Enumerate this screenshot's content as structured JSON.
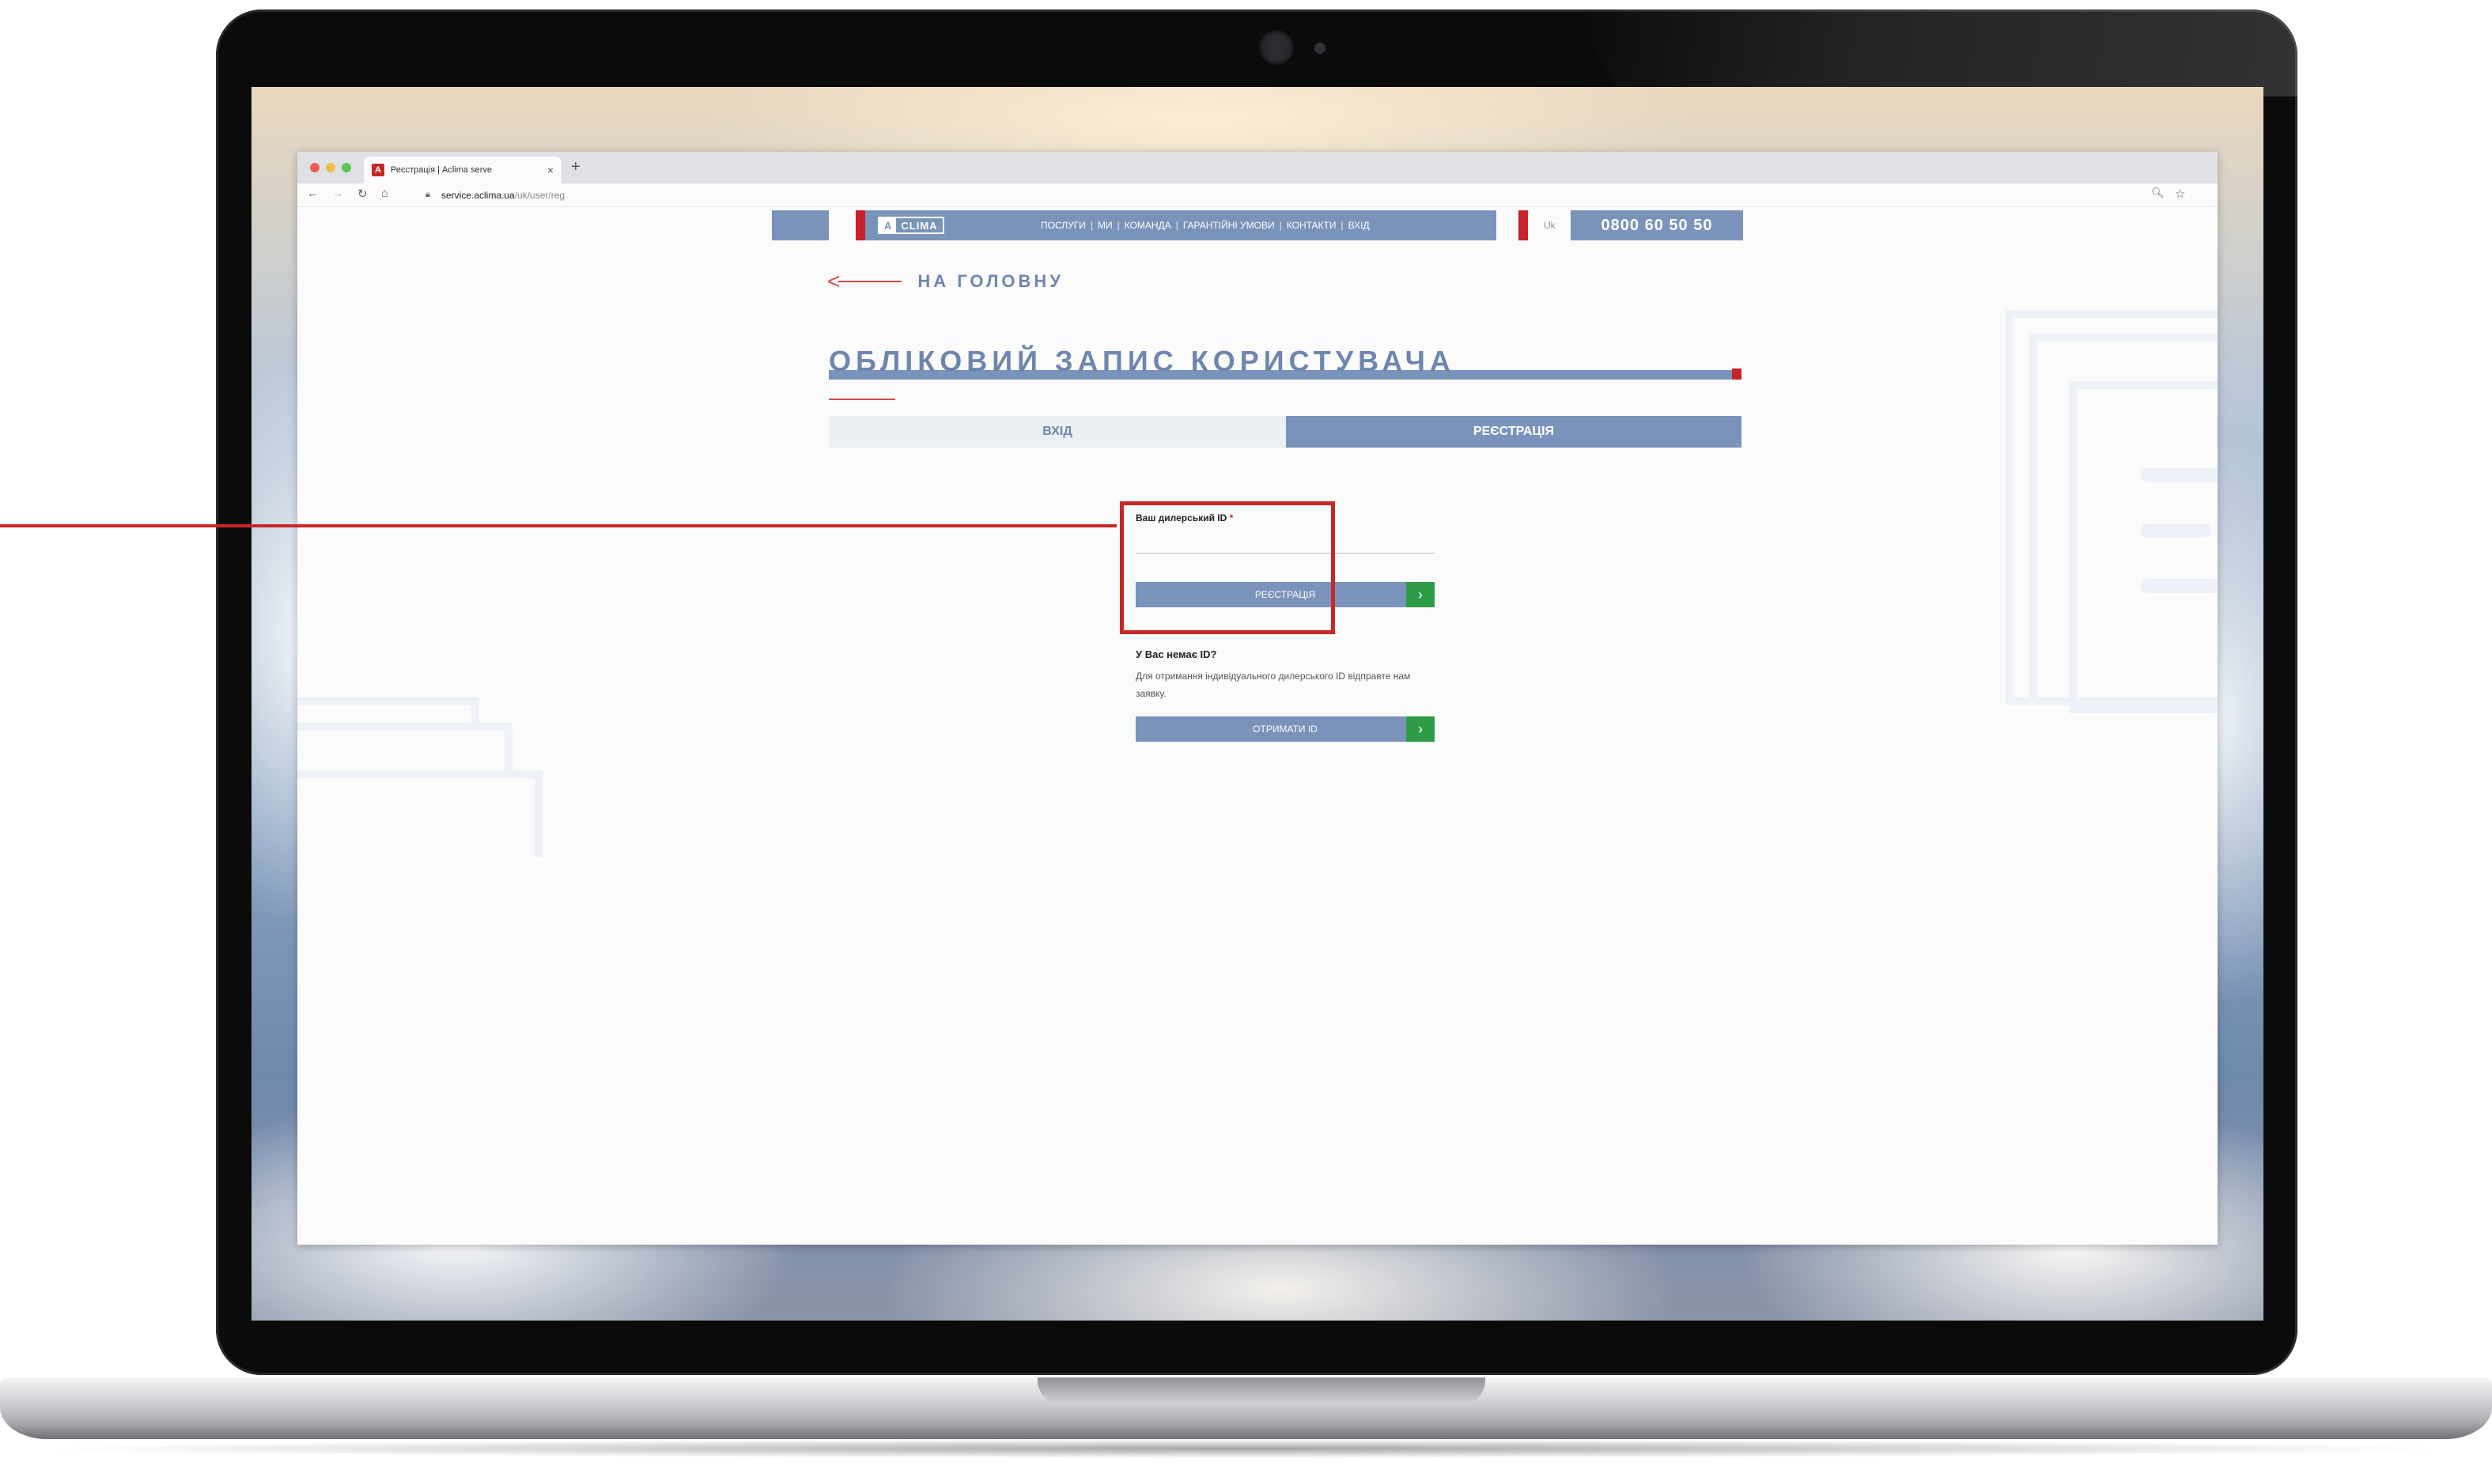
{
  "browser": {
    "tab_title": "Реєстрація | Aclima serve",
    "tab_close": "×",
    "new_tab": "+",
    "url_host": "service.aclima.ua",
    "url_path": "/uk/user/reg",
    "favicon_letter": "A"
  },
  "header": {
    "logo_a": "A",
    "logo_text": "CLIMA",
    "nav": [
      "ПОСЛУГИ",
      "МИ",
      "КОМАНДА",
      "ГАРАНТІЙНІ УМОВИ",
      "КОНТАКТИ",
      "ВХІД"
    ],
    "nav_separator": "|",
    "lang": "Uk",
    "phone": "0800 60 50 50"
  },
  "back": {
    "arrow": "<",
    "label": "НА ГОЛОВНУ"
  },
  "page_title": "ОБЛІКОВИЙ ЗАПИС КОРИСТУВАЧА",
  "tabs": {
    "login": "ВХІД",
    "register": "РЕЄСТРАЦІЯ"
  },
  "form": {
    "label": "Ваш дилерський ID",
    "required_mark": "*",
    "input_value": "",
    "submit": "РЕЄСТРАЦІЯ",
    "go_glyph": "›"
  },
  "no_id": {
    "title": "У Вас немає ID?",
    "text": "Для отримання індивідуального дилерського ID відправте нам заявку.",
    "button": "ОТРИМАТИ ID"
  },
  "colors": {
    "brand_blue": "#7a93bb",
    "accent_red": "#c8222a",
    "go_green": "#2e9b47",
    "highlight_red": "#c62828"
  }
}
